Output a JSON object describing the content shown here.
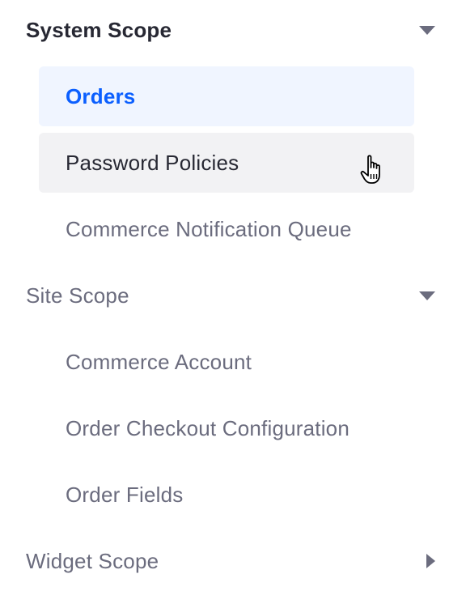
{
  "sections": [
    {
      "title": "System Scope",
      "expanded": true,
      "items": [
        "Orders",
        "Password Policies",
        "Commerce Notification Queue"
      ],
      "active_item": "Orders",
      "hovered_item": "Password Policies"
    },
    {
      "title": "Site Scope",
      "expanded": true,
      "items": [
        "Commerce Account",
        "Order Checkout Configuration",
        "Order Fields"
      ]
    },
    {
      "title": "Widget Scope",
      "expanded": false,
      "items": []
    }
  ],
  "colors": {
    "accent": "#0b5fff",
    "active_bg": "#f0f5ff",
    "hover_bg": "#f2f2f4",
    "text_strong": "#272833",
    "text_muted": "#6b6c7e"
  },
  "icons": {
    "expanded": "caret-down-icon",
    "collapsed": "caret-right-icon",
    "pointer": "hand-pointer-cursor-icon"
  }
}
